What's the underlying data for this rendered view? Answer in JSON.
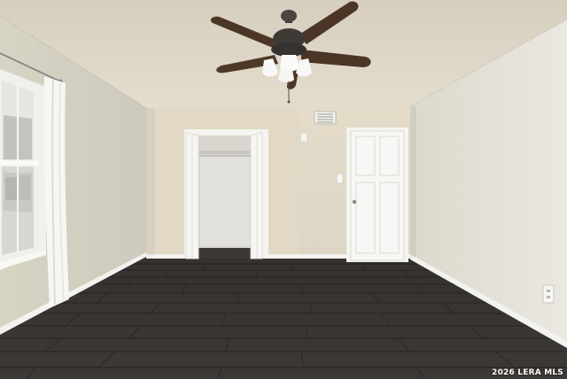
{
  "photo": {
    "subject": "empty-bedroom-interior",
    "features": [
      "ceiling-fan",
      "double-hung-window",
      "curtain",
      "open-closet",
      "white-door",
      "hvac-vent",
      "outlet",
      "wood-look-tile-floor"
    ]
  },
  "watermark": {
    "text": "2026 LERA MLS"
  },
  "colors": {
    "ceiling": "#ddd6c6",
    "wall_back": "#e2dac8",
    "wall_left": "#d3cfc2",
    "wall_right": "#e6e2d9",
    "floor": "#3a3734",
    "trim": "#f3f3ef",
    "fan_blade": "#4a3526"
  }
}
